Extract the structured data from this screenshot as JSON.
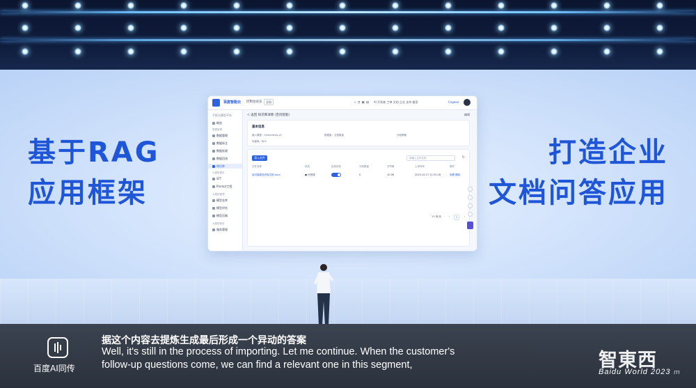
{
  "backdrop": {
    "left_title_line1": "基于RAG",
    "left_title_line2": "应用框架",
    "right_title_line1": "打造企业",
    "right_title_line2": "文档问答应用",
    "accent_color": "#1f56d8"
  },
  "app": {
    "brand": "百度智能云",
    "console_tab": "控制台总览",
    "region": "全局",
    "header_links": "AI 开发者   工单   文档   企业   支持   备案",
    "user": "Cogaoo",
    "sidebar_top": "千帆大模型平台",
    "sidebar": [
      {
        "label": "概览"
      },
      {
        "label": "数据管理"
      },
      {
        "label": "数据标注"
      },
      {
        "label": "数据处理"
      },
      {
        "label": "数据回流"
      },
      {
        "label": "知识库"
      },
      {
        "label": "SFT"
      },
      {
        "label": "Prompt工程"
      },
      {
        "label": "模型仓库"
      },
      {
        "label": "模型评估"
      },
      {
        "label": "模型压缩"
      },
      {
        "label": "服务管理"
      }
    ],
    "sidebar_groups": [
      "数据管理",
      "大模型调优",
      "大模型管理",
      "大模型服务"
    ],
    "breadcrumb": "< 返回   知识库详情 (百问智能)",
    "edit": "编辑",
    "basic_info_title": "基本信息",
    "info": [
      "嵌入模型：Embedding-V1",
      "向量库：BES",
      "数据量：文档数量",
      "分段策略"
    ],
    "import_button": "导入文件",
    "search_placeholder": "请输入文件名称",
    "table_headers": [
      "文件名称",
      "状态",
      "启用状态",
      "分段数量",
      "字符数",
      "上传时间",
      "操作"
    ],
    "table_row": {
      "name": "百问智能知识库文档.docx",
      "status": "● 已完成",
      "segments": "0",
      "chars": "10.5K",
      "time": "2023-10-17 11:32:18",
      "actions": "查看  删除"
    },
    "pager_label": "10 条/页",
    "pager_page": "1"
  },
  "subtitle": {
    "cn": "据这个内容去提炼生成最后形成一个异动的答案",
    "en_line1": "Well, it's still in the process of importing. Let me continue. When the customer's",
    "en_line2": "follow-up questions come, we can find a relevant one in this segment,"
  },
  "watermarks": {
    "baidu_ai": "百度AI同传",
    "zhidongxi": "智東西",
    "baidu_world": "Baidu World 2023"
  }
}
